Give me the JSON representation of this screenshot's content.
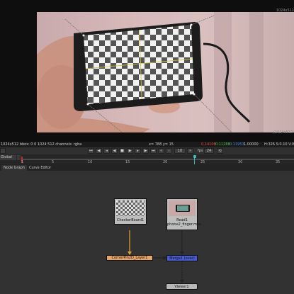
{
  "viewer": {
    "resolution_top": "1024x512",
    "resolution_bottom": "(1024x512)"
  },
  "info_bar": {
    "format": "1024x512  bbox: 0 0 1024 512 channels: rgba",
    "coords": "x= 788 y=  15",
    "r": "0.14108",
    "g": "0.11288",
    "b": "0.11953",
    "a": "1.00000",
    "hsv": "H:326 S:0.10 V:0"
  },
  "transport": {
    "frame": "10",
    "fps_label": "fps",
    "fps": "24"
  },
  "timeline": {
    "global_label": "Global",
    "ticks": [
      "1",
      "5",
      "10",
      "15",
      "20",
      "25",
      "30",
      "35"
    ],
    "current_frame": 25
  },
  "tabs": [
    {
      "label": "Node Graph"
    },
    {
      "label": "Curve Editor"
    }
  ],
  "nodes": {
    "checkerboard": "CheckerBoard1",
    "read_name": "Read1",
    "read_file": "phone2_finger.mov",
    "corner_pin": "CornerPin2D_Layer1",
    "merge": "Merge1 (over)",
    "viewer": "Viewer1"
  },
  "colors": {
    "red_channel": "#e04040",
    "green_channel": "#40c040",
    "blue_channel": "#4080e0",
    "corner_pin_node": "#e0a060",
    "merge_node": "#4a5ad0",
    "timeline_marker": "#30c0c0"
  }
}
